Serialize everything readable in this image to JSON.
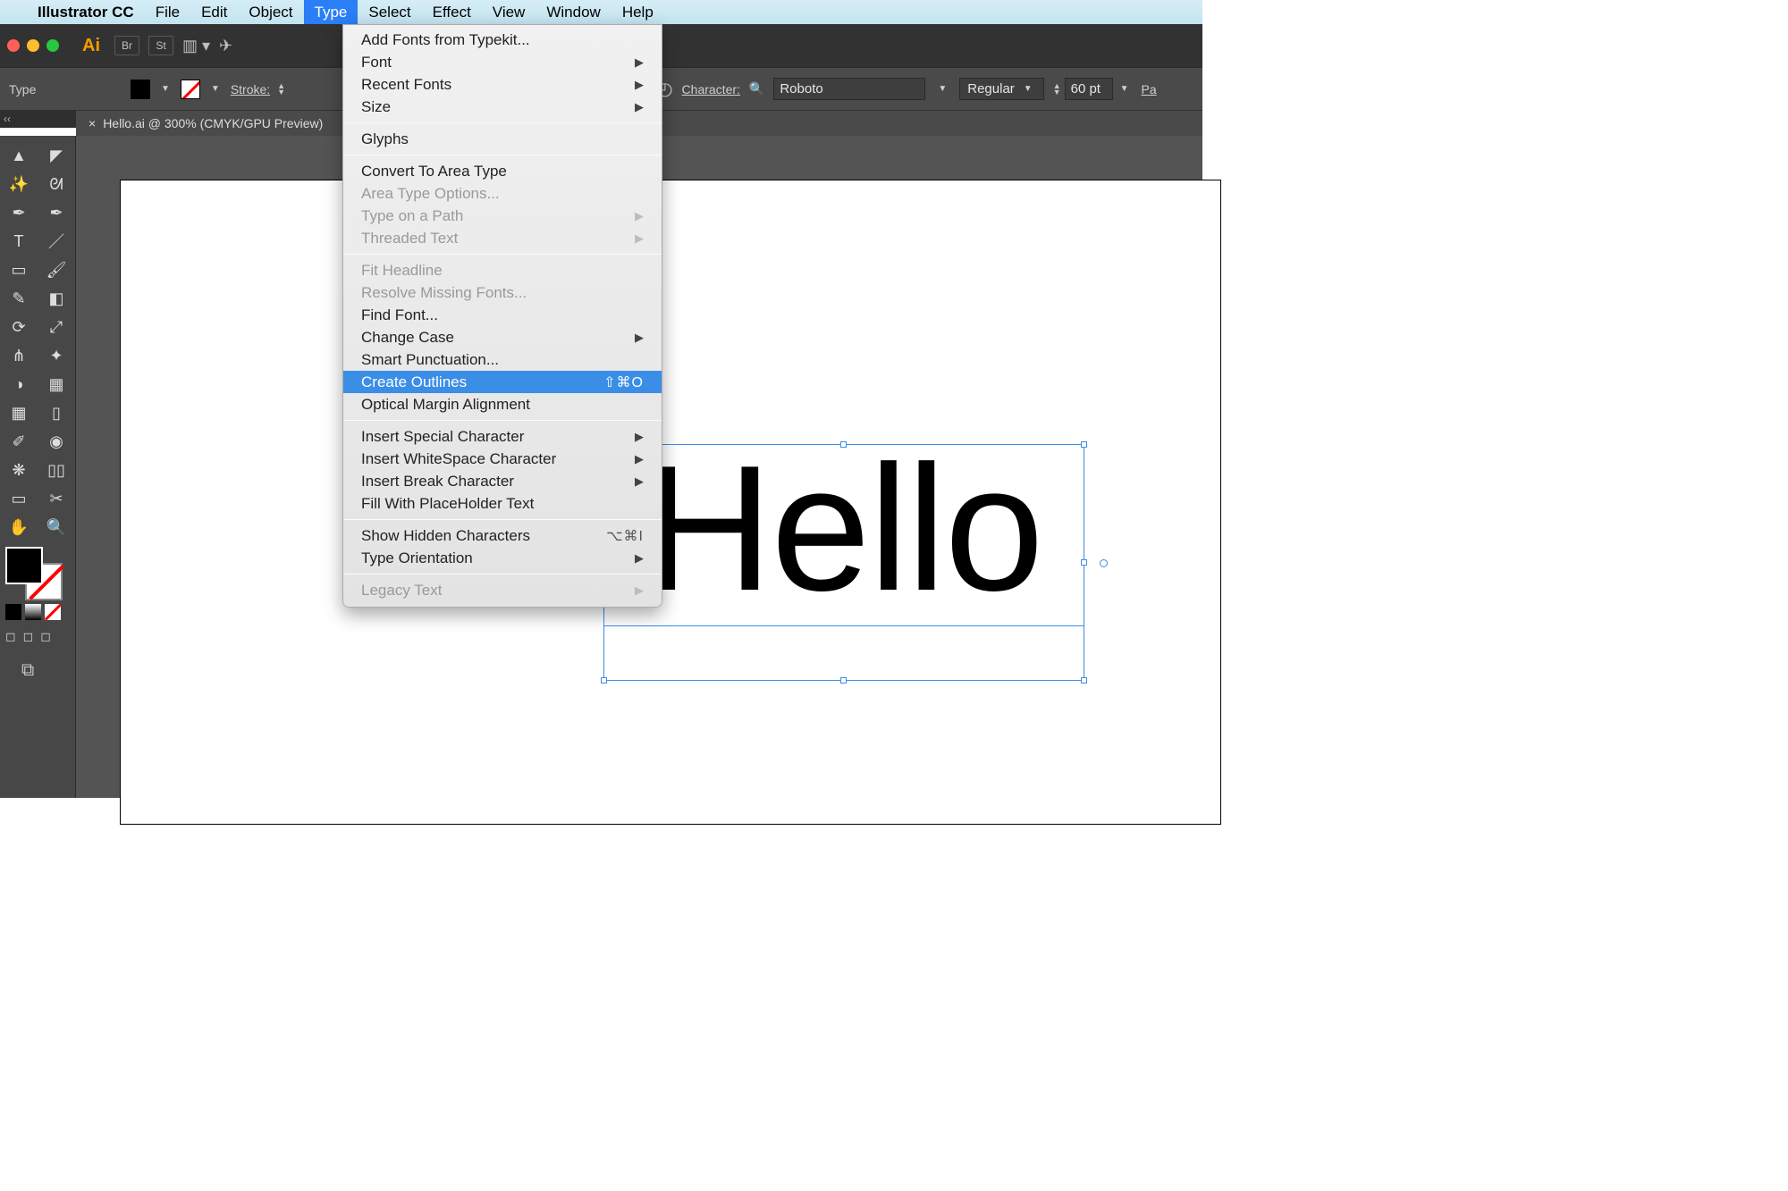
{
  "menubar": {
    "app": "Illustrator CC",
    "items": [
      "File",
      "Edit",
      "Object",
      "Type",
      "Select",
      "Effect",
      "View",
      "Window",
      "Help"
    ],
    "active_index": 3
  },
  "optionsbar": {
    "tool_label": "Type",
    "stroke_label": "Stroke:",
    "character_label": "Character:",
    "font_value": "Roboto",
    "style_value": "Regular",
    "size_value": "60 pt",
    "paragraph_cut": "Pa"
  },
  "document_tab": {
    "close_glyph": "×",
    "title": "Hello.ai @ 300% (CMYK/GPU Preview)"
  },
  "canvas": {
    "text": "Hello"
  },
  "type_menu": {
    "groups": [
      [
        {
          "label": "Add Fonts from Typekit...",
          "enabled": true
        },
        {
          "label": "Font",
          "enabled": true,
          "submenu": true
        },
        {
          "label": "Recent Fonts",
          "enabled": true,
          "submenu": true
        },
        {
          "label": "Size",
          "enabled": true,
          "submenu": true
        }
      ],
      [
        {
          "label": "Glyphs",
          "enabled": true
        }
      ],
      [
        {
          "label": "Convert To Area Type",
          "enabled": true
        },
        {
          "label": "Area Type Options...",
          "enabled": false
        },
        {
          "label": "Type on a Path",
          "enabled": false,
          "submenu": true
        },
        {
          "label": "Threaded Text",
          "enabled": false,
          "submenu": true
        }
      ],
      [
        {
          "label": "Fit Headline",
          "enabled": false
        },
        {
          "label": "Resolve Missing Fonts...",
          "enabled": false
        },
        {
          "label": "Find Font...",
          "enabled": true
        },
        {
          "label": "Change Case",
          "enabled": true,
          "submenu": true
        },
        {
          "label": "Smart Punctuation...",
          "enabled": true
        },
        {
          "label": "Create Outlines",
          "enabled": true,
          "shortcut": "⇧⌘O",
          "selected": true
        },
        {
          "label": "Optical Margin Alignment",
          "enabled": true
        }
      ],
      [
        {
          "label": "Insert Special Character",
          "enabled": true,
          "submenu": true
        },
        {
          "label": "Insert WhiteSpace Character",
          "enabled": true,
          "submenu": true
        },
        {
          "label": "Insert Break Character",
          "enabled": true,
          "submenu": true
        },
        {
          "label": "Fill With PlaceHolder Text",
          "enabled": true
        }
      ],
      [
        {
          "label": "Show Hidden Characters",
          "enabled": true,
          "shortcut": "⌥⌘I"
        },
        {
          "label": "Type Orientation",
          "enabled": true,
          "submenu": true
        }
      ],
      [
        {
          "label": "Legacy Text",
          "enabled": false,
          "submenu": true
        }
      ]
    ]
  },
  "apptop_chips": {
    "br": "Br",
    "st": "St"
  }
}
